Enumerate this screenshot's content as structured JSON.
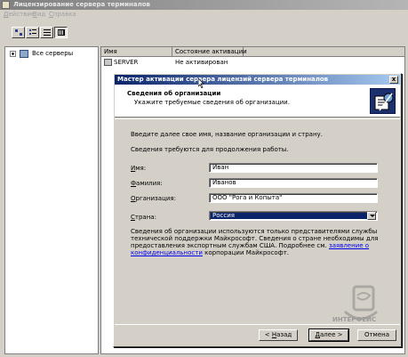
{
  "window": {
    "title": "Лицензирование сервера терминалов",
    "menu": [
      {
        "label": "Действие",
        "hotkey": "Д",
        "rest": "ействие"
      },
      {
        "label": "Вид",
        "hotkey": "В",
        "rest": "ид"
      },
      {
        "label": "Справка",
        "hotkey": "С",
        "rest": "правка"
      }
    ]
  },
  "toolbar": {
    "icons": [
      "large-icons-view-icon",
      "small-icons-view-icon",
      "list-view-icon",
      "details-view-icon"
    ]
  },
  "tree": {
    "root_label": "Все серверы"
  },
  "list": {
    "columns": [
      "Имя",
      "Состояние активации"
    ],
    "rows": [
      {
        "name": "SERVER",
        "status": "Не активирован"
      }
    ]
  },
  "dialog": {
    "title": "Мастер активации сервера лицензий сервера терминалов",
    "close": "x",
    "header_title": "Сведения об организации",
    "header_subtitle": "Укажите требуемые сведения об организации.",
    "intro": "Введите далее свое имя, название организации и страну.",
    "required": "Сведения требуются для продолжения работы.",
    "fields": {
      "name": {
        "label_hot": "И",
        "label_rest": "мя:",
        "value": "Иван"
      },
      "surname": {
        "label_hot": "Ф",
        "label_rest": "амилия:",
        "value": "Иванов"
      },
      "organization": {
        "label_hot": "О",
        "label_rest": "рганизация:",
        "value": "ООО \"Рога и Копыта\""
      },
      "country": {
        "label_hot": "С",
        "label_rest": "трана:",
        "value": "Россия"
      }
    },
    "notice": {
      "text": "Сведения об организации используются только представителями службы технической поддержки Майкрософт. Сведения о стране необходимы для предоставления экспортным службам США. Подробнее см. ",
      "link": "заявление о конфиденциальности",
      "tail": " корпорации Майкрософт."
    },
    "watermark": "ИНТЕРФЕЙС",
    "buttons": {
      "back": {
        "prefix": "< ",
        "hot": "Н",
        "rest": "азад"
      },
      "next": {
        "hot": "Д",
        "rest": "алее >"
      },
      "cancel": "Отмена"
    }
  },
  "colors": {
    "dialog_title_start": "#0a246a",
    "dialog_title_end": "#a6caf0",
    "selection": "#0a246a",
    "link": "#0000ee"
  }
}
